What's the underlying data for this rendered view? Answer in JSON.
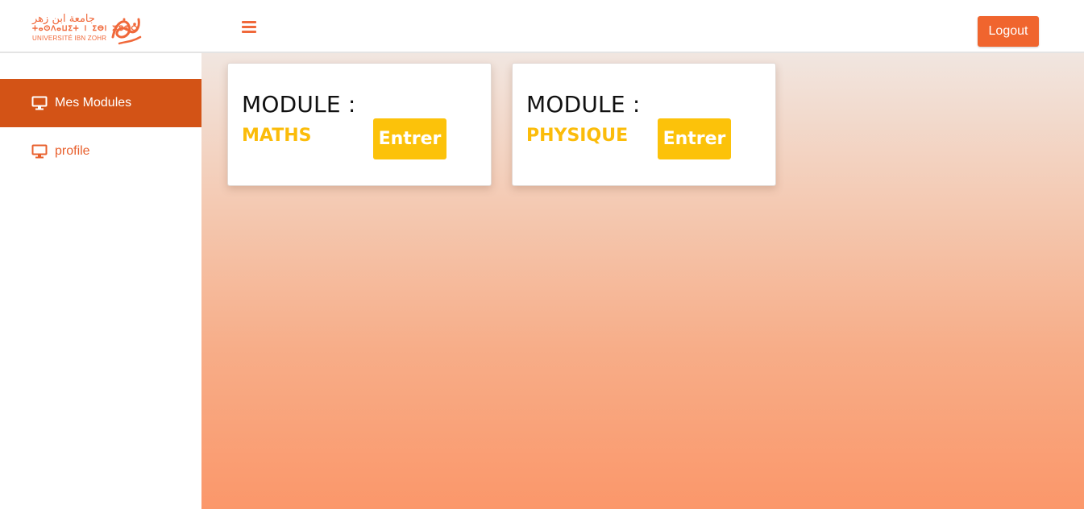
{
  "header": {
    "logo": {
      "arabic": "جامعة ابن زهر",
      "tifinagh": "ⵜⴰⵙⴷⴰⵡⵉⵜ ⵏ ⵉⴱⵏ ⵣⵓⵀⵔ",
      "french": "UNIVERSITÉ IBN ZOHR"
    },
    "menu_icon": "hamburger-icon",
    "logout_label": "Logout"
  },
  "sidebar": {
    "items": [
      {
        "label": "Mes Modules",
        "icon": "monitor-icon",
        "active": true
      },
      {
        "label": "profile",
        "icon": "monitor-icon",
        "active": false
      }
    ]
  },
  "modules": [
    {
      "label": "MODULE :",
      "name": "MATHS",
      "button": "Entrer"
    },
    {
      "label": "MODULE :",
      "name": "PHYSIQUE",
      "button": "Entrer"
    }
  ],
  "colors": {
    "accent": "#f0652e",
    "sidebar_active": "#d35316",
    "module_yellow": "#fcc20a"
  }
}
